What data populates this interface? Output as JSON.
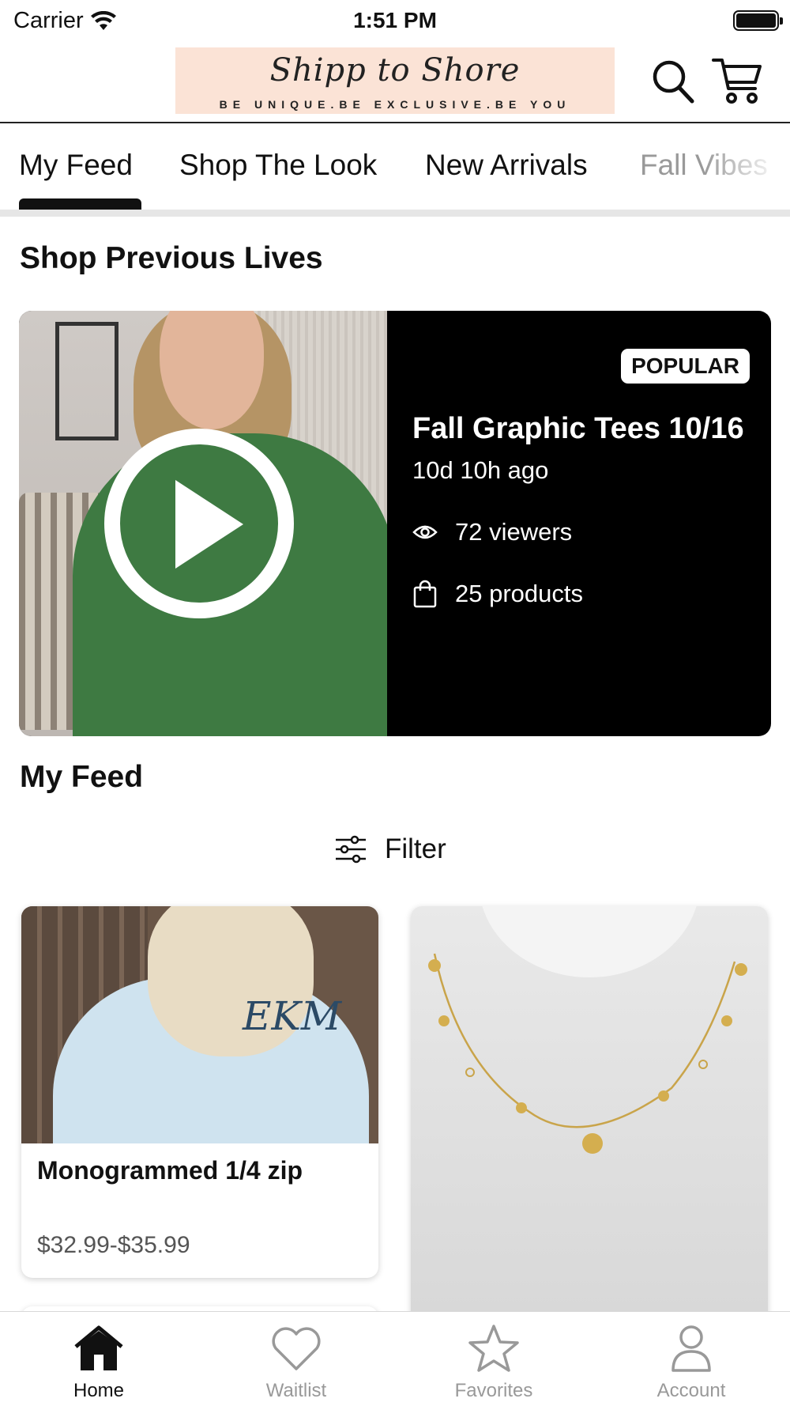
{
  "status_bar": {
    "carrier": "Carrier",
    "time": "1:51 PM"
  },
  "header": {
    "logo_script": "Shipp to Shore",
    "logo_tagline": "BE UNIQUE.BE EXCLUSIVE.BE YOU",
    "logo_bg": "#fbe3d6"
  },
  "tabs": {
    "items": [
      {
        "label": "My Feed",
        "active": true
      },
      {
        "label": "Shop The Look",
        "active": false
      },
      {
        "label": "New Arrivals",
        "active": false
      },
      {
        "label": "Fall Vibes",
        "active": false
      }
    ]
  },
  "previous_lives": {
    "title": "Shop Previous Lives",
    "card": {
      "badge": "POPULAR",
      "title": "Fall Graphic Tees 10/16",
      "ago": "10d 10h ago",
      "viewers": "72 viewers",
      "products": "25 products"
    }
  },
  "feed": {
    "title": "My Feed",
    "filter_label": "Filter",
    "products": [
      {
        "name": "Monogrammed 1/4 zip",
        "price": "$32.99-$35.99",
        "image": "sweatshirt-photo",
        "monogram": "EKM"
      },
      {
        "name": "",
        "price": "",
        "image": "necklace-photo"
      }
    ]
  },
  "bottom_nav": {
    "items": [
      {
        "label": "Home",
        "icon": "home-icon",
        "active": true
      },
      {
        "label": "Waitlist",
        "icon": "heart-icon",
        "active": false
      },
      {
        "label": "Favorites",
        "icon": "star-icon",
        "active": false
      },
      {
        "label": "Account",
        "icon": "person-icon",
        "active": false
      }
    ]
  }
}
